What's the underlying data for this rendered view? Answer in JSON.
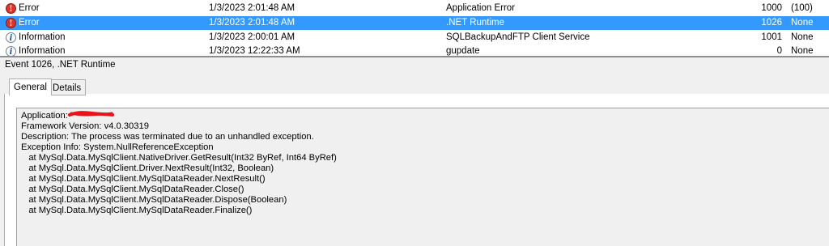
{
  "event_list": {
    "rows": [
      {
        "level": "Error",
        "date": "1/3/2023 2:01:48 AM",
        "source": "Application Error",
        "event_id": "1000",
        "category": "(100)",
        "icon": "error-icon"
      },
      {
        "level": "Error",
        "date": "1/3/2023 2:01:48 AM",
        "source": ".NET Runtime",
        "event_id": "1026",
        "category": "None",
        "icon": "error-icon",
        "selected": true
      },
      {
        "level": "Information",
        "date": "1/3/2023 2:00:01 AM",
        "source": "SQLBackupAndFTP Client Service",
        "event_id": "1001",
        "category": "None",
        "icon": "information-icon"
      },
      {
        "level": "Information",
        "date": "1/3/2023 12:22:33 AM",
        "source": "gupdate",
        "event_id": "0",
        "category": "None",
        "icon": "information-icon"
      }
    ]
  },
  "detail": {
    "title": "Event 1026, .NET Runtime",
    "tabs": [
      "General",
      "Details"
    ],
    "description_lines": [
      "Application:",
      "Framework Version: v4.0.30319",
      "Description: The process was terminated due to an unhandled exception.",
      "Exception Info: System.NullReferenceException",
      "   at MySql.Data.MySqlClient.NativeDriver.GetResult(Int32 ByRef, Int64 ByRef)",
      "   at MySql.Data.MySqlClient.Driver.NextResult(Int32, Boolean)",
      "   at MySql.Data.MySqlClient.MySqlDataReader.NextResult()",
      "   at MySql.Data.MySqlClient.MySqlDataReader.Close()",
      "   at MySql.Data.MySqlClient.MySqlDataReader.Dispose(Boolean)",
      "   at MySql.Data.MySqlClient.MySqlDataReader.Finalize()"
    ]
  },
  "colors": {
    "selection": "#3399ff",
    "error_icon": "#d9352b",
    "info_icon": "#1e4fa0",
    "redaction": "#e8141c"
  }
}
